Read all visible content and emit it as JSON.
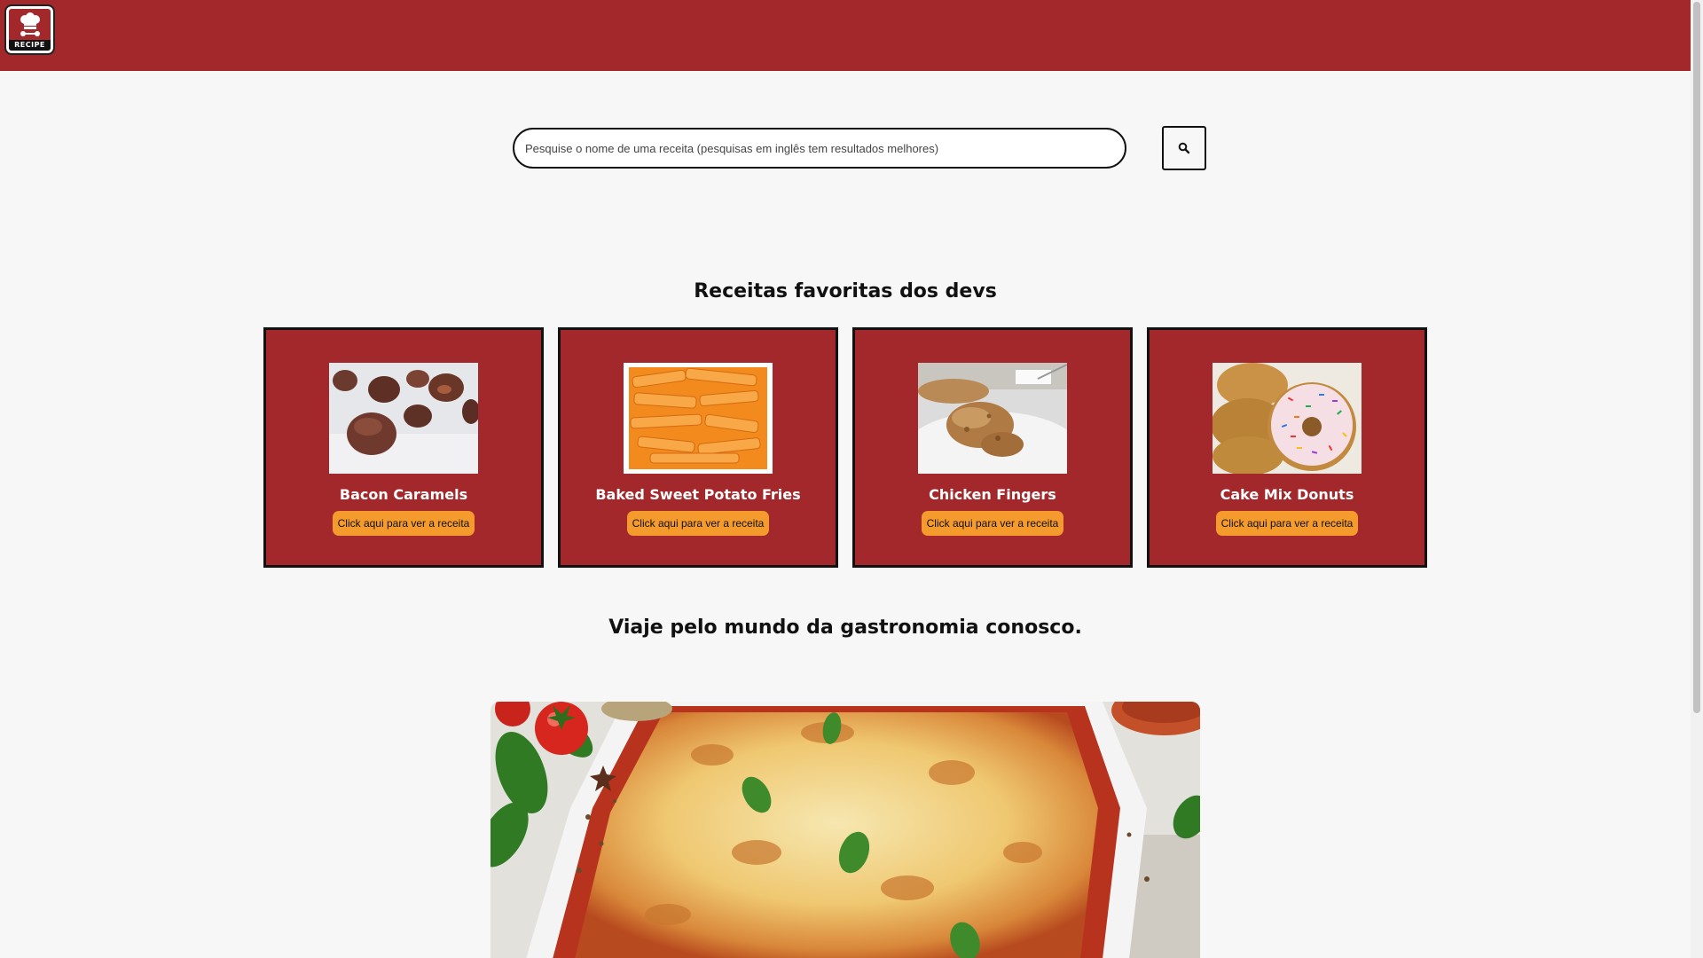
{
  "header": {
    "logo_text": "RECIPE",
    "brand_color": "#a2282b"
  },
  "search": {
    "placeholder": "Pesquise o nome de uma receita (pesquisas em inglês tem resultados melhores)",
    "button_icon": "search-icon"
  },
  "favorites": {
    "title": "Receitas favoritas dos devs",
    "button_color": "#f59a2c",
    "cards": [
      {
        "name": "Bacon Caramels",
        "button_label": "Click aqui para ver a receita",
        "image": "bacon-caramels-photo"
      },
      {
        "name": "Baked Sweet Potato Fries",
        "button_label": "Click aqui para ver a receita",
        "image": "sweet-potato-fries-photo"
      },
      {
        "name": "Chicken Fingers",
        "button_label": "Click aqui para ver a receita",
        "image": "chicken-fingers-photo"
      },
      {
        "name": "Cake Mix Donuts",
        "button_label": "Click aqui para ver a receita",
        "image": "cake-mix-donuts-photo"
      }
    ]
  },
  "travel": {
    "title": "Viaje pelo mundo da gastronomia conosco.",
    "image": "lasagna-photo"
  }
}
